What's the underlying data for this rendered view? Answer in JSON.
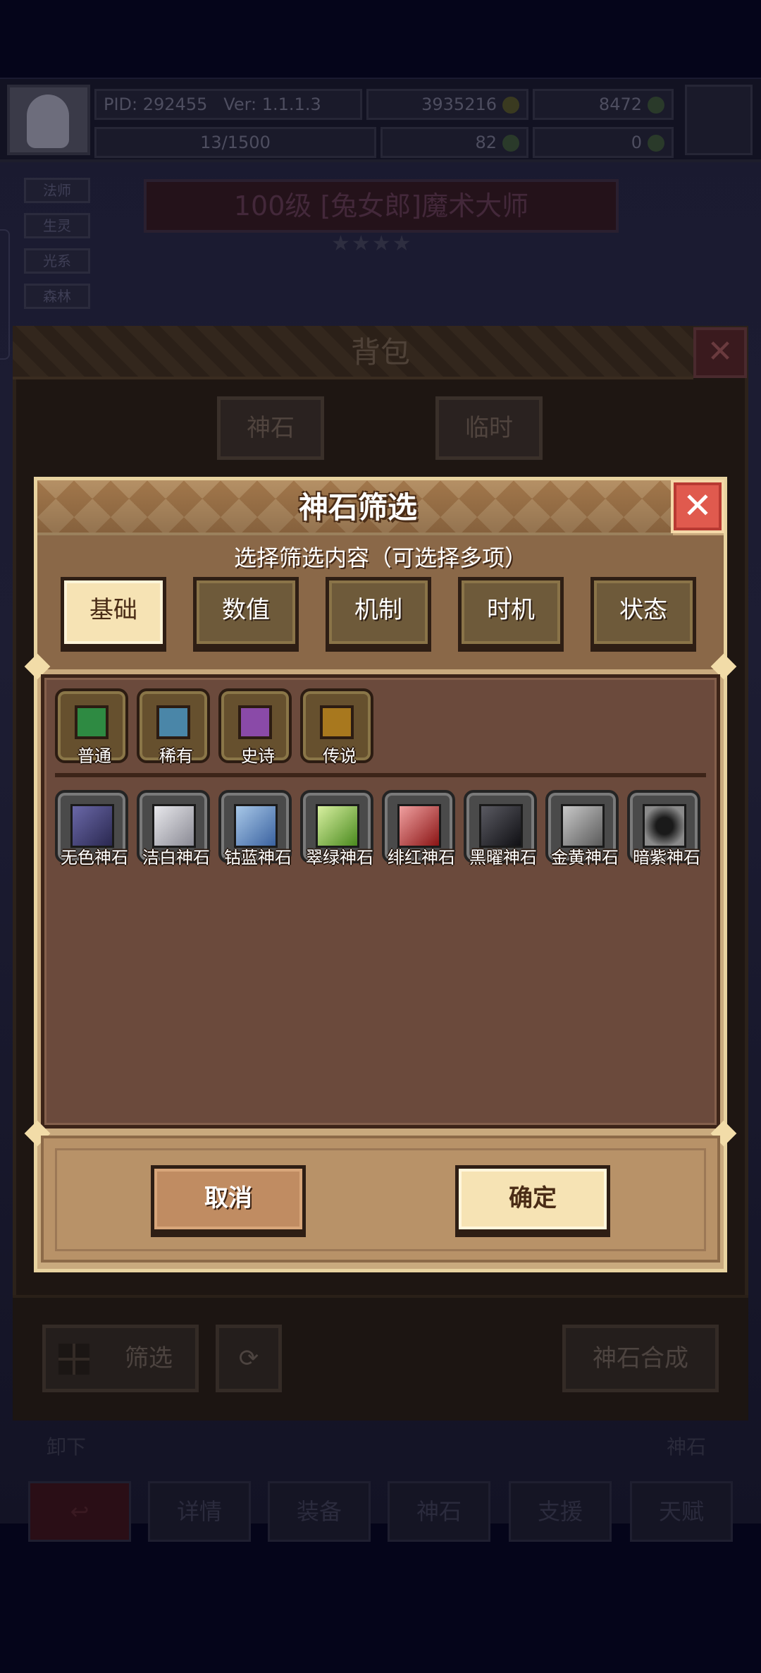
{
  "top_bar": {
    "pid": "PID: 292455",
    "version": "Ver: 1.1.1.3",
    "gold": "3935216",
    "gems": "8472",
    "exp": "13/1500",
    "clover": "82",
    "keys": "0"
  },
  "side_tabs": [
    "法师",
    "生灵",
    "光系",
    "森林"
  ],
  "hero": {
    "title": "100级 [兔女郎]魔术大师",
    "stars": "★★★★"
  },
  "bag": {
    "title": "背包",
    "tabs": [
      "神石",
      "临时"
    ],
    "filter_label": "筛选",
    "synth_label": "神石合成",
    "under_labels": [
      "卸下",
      "神石"
    ]
  },
  "bottom_nav": [
    "详情",
    "装备",
    "神石",
    "支援",
    "天赋"
  ],
  "filter_modal": {
    "title": "神石筛选",
    "subtitle": "选择筛选内容（可选择多项）",
    "categories": [
      {
        "label": "基础",
        "active": true
      },
      {
        "label": "数值",
        "active": false
      },
      {
        "label": "机制",
        "active": false
      },
      {
        "label": "时机",
        "active": false
      },
      {
        "label": "状态",
        "active": false
      }
    ],
    "rarities": [
      {
        "label": "普通",
        "color": "#2e8a42"
      },
      {
        "label": "稀有",
        "color": "#4a86a8"
      },
      {
        "label": "史诗",
        "color": "#8a4aa8"
      },
      {
        "label": "传说",
        "color": "#a8781e"
      }
    ],
    "stones": [
      {
        "label": "无色神石",
        "color": "#3a3868"
      },
      {
        "label": "洁白神石",
        "color": "#b8b8c0"
      },
      {
        "label": "钴蓝神石",
        "color": "#5a82b8"
      },
      {
        "label": "翠绿神石",
        "color": "#7ab83a"
      },
      {
        "label": "绯红神石",
        "color": "#b82a2a"
      },
      {
        "label": "黑曜神石",
        "color": "#222228"
      },
      {
        "label": "金黄神石",
        "color": "#8a8a8a"
      },
      {
        "label": "暗紫神石",
        "color": "#3a3a3a"
      }
    ],
    "cancel_label": "取消",
    "confirm_label": "确定"
  }
}
